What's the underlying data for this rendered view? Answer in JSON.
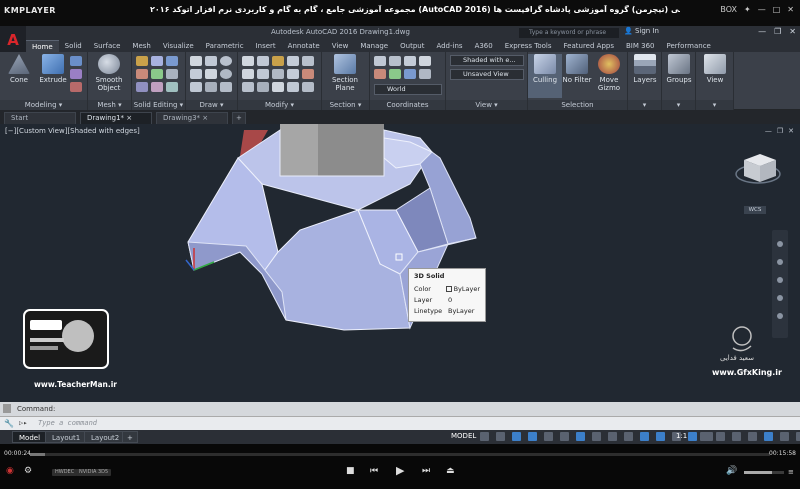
{
  "player": {
    "logo": "KMPLAYER",
    "title": "مجموعه آموزشی جامع ، گام به گام و کاربردی نرم افزار  اتوکد ۲۰۱۶ (AutoCAD 2016)  مدرس : سعید فدایی (تیچرمن) گروه آموزشی پادشاه گرافیست ها",
    "box_label": "BOX",
    "time_elapsed": "00:00:24",
    "time_total": "00:15:58",
    "progress": 0.02,
    "pill1": "HWDEC",
    "pill2": "NVIDIA 3D5"
  },
  "acad": {
    "app_title": "Autodesk AutoCAD 2016    Drawing1.dwg",
    "search_placeholder": "Type a keyword or phrase",
    "signin": "Sign In",
    "logo": "A",
    "ribbon_tabs": [
      "Home",
      "Solid",
      "Surface",
      "Mesh",
      "Visualize",
      "Parametric",
      "Insert",
      "Annotate",
      "View",
      "Manage",
      "Output",
      "Add-ins",
      "A360",
      "Express Tools",
      "Featured Apps",
      "BIM 360",
      "Performance"
    ],
    "ribbon": {
      "cone": "Cone",
      "extrude": "Extrude",
      "smooth_object": "Smooth Object",
      "section_plane": "Section Plane",
      "culling": "Culling",
      "no_filter": "No Filter",
      "move_gizmo": "Move Gizmo",
      "layers": "Layers",
      "groups": "Groups",
      "view": "View",
      "visual_style": "Shaded with e...",
      "saved_view": "Unsaved View",
      "ucs": "World",
      "panels": {
        "modeling": "Modeling",
        "mesh": "Mesh",
        "solid_editing": "Solid Editing",
        "draw": "Draw",
        "modify": "Modify",
        "section": "Section",
        "coordinates": "Coordinates",
        "view": "View",
        "selection": "Selection"
      }
    },
    "doc_tabs": [
      "Start",
      "Drawing1*",
      "Drawing3*"
    ],
    "viewport_label": "[−][Custom View][Shaded with edges]",
    "viewcube_wcs": "WCS",
    "tooltip": {
      "title": "3D Solid",
      "rows": [
        {
          "key": "Color",
          "value": "ByLayer"
        },
        {
          "key": "Layer",
          "value": "0"
        },
        {
          "key": "Linetype",
          "value": "ByLayer"
        }
      ]
    },
    "command_history": "Command:",
    "command_prompt": "▷▸",
    "command_placeholder": "Type a command",
    "layout_tabs": [
      "Model",
      "Layout1",
      "Layout2"
    ],
    "status_model": "MODEL",
    "status_scale": "1:1"
  },
  "watermarks": {
    "teacherman_url": "www.TeacherMan.ir",
    "gfx_name": "سعید فدایی",
    "gfx_url": "www.GfxKing.ir"
  },
  "colors": {
    "solid_fill": "#a8b2e0",
    "viewport_bg": "#212831",
    "ribbon_bg": "#3b4049",
    "accent_red": "#d9262b"
  }
}
